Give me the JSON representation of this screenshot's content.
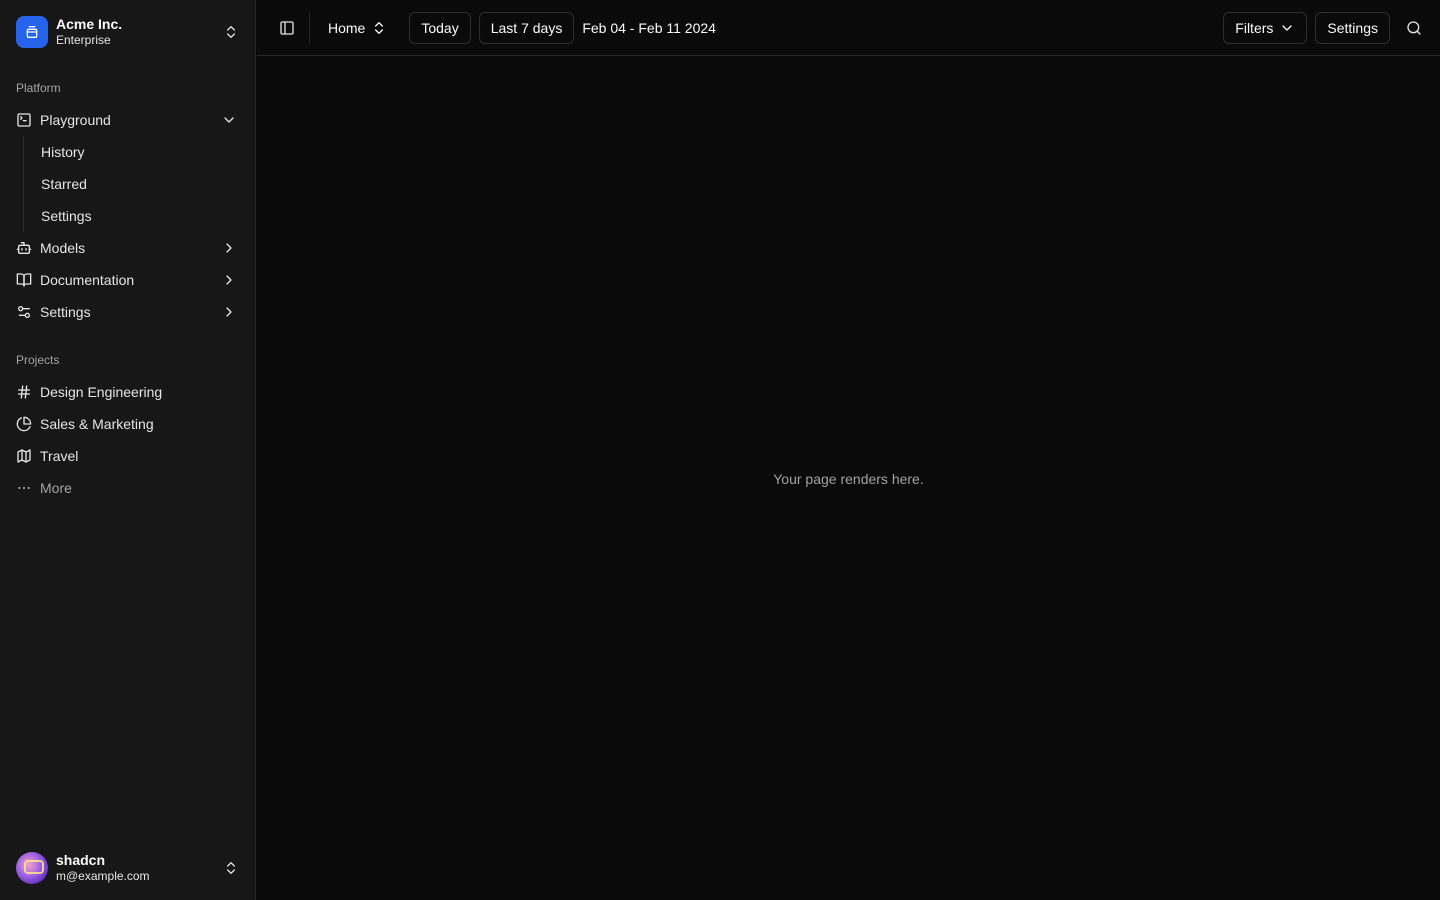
{
  "team": {
    "name": "Acme Inc.",
    "plan": "Enterprise"
  },
  "platform": {
    "label": "Platform",
    "items": [
      {
        "label": "Playground",
        "icon": "square-terminal-icon",
        "expanded": true,
        "children": [
          {
            "label": "History"
          },
          {
            "label": "Starred"
          },
          {
            "label": "Settings"
          }
        ]
      },
      {
        "label": "Models",
        "icon": "bot-icon"
      },
      {
        "label": "Documentation",
        "icon": "book-open-icon"
      },
      {
        "label": "Settings",
        "icon": "settings-sliders-icon"
      }
    ]
  },
  "projects": {
    "label": "Projects",
    "items": [
      {
        "label": "Design Engineering",
        "icon": "hash-icon"
      },
      {
        "label": "Sales & Marketing",
        "icon": "pie-chart-icon"
      },
      {
        "label": "Travel",
        "icon": "map-icon"
      }
    ],
    "more_label": "More"
  },
  "user": {
    "name": "shadcn",
    "email": "m@example.com"
  },
  "header": {
    "home_label": "Home",
    "today_label": "Today",
    "last7_label": "Last 7 days",
    "date_range": "Feb 04 - Feb 11 2024",
    "filters_label": "Filters",
    "settings_label": "Settings"
  },
  "main": {
    "placeholder": "Your page renders here."
  },
  "colors": {
    "accent": "#2563eb",
    "background": "#0a0a0a",
    "sidebar": "#171717"
  }
}
